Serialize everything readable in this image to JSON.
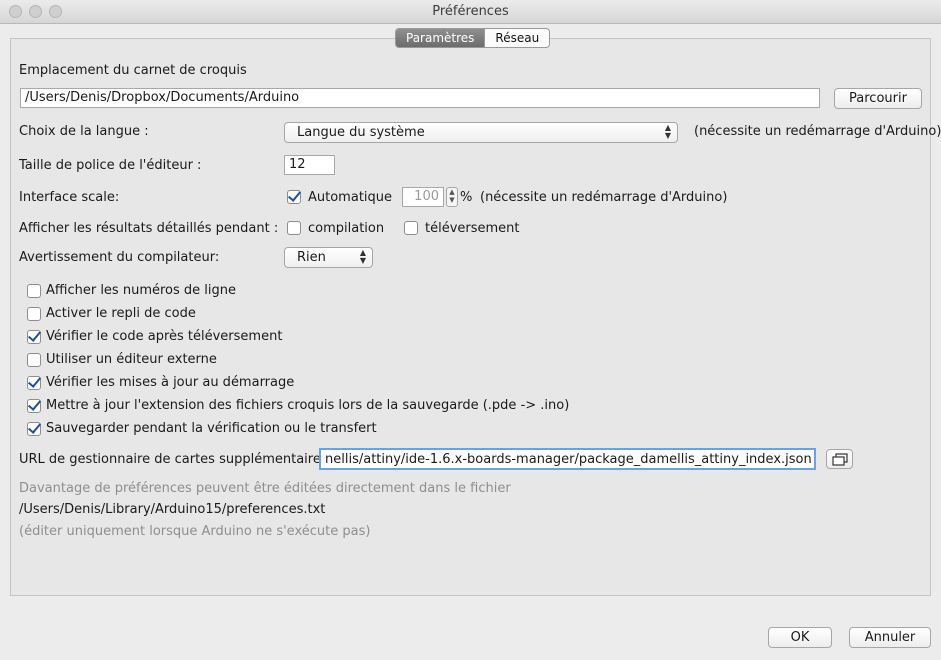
{
  "window": {
    "title": "Préférences"
  },
  "tabs": [
    {
      "label": "Paramètres",
      "active": true
    },
    {
      "label": "Réseau",
      "active": false
    }
  ],
  "sketchbook": {
    "label": "Emplacement du carnet de croquis",
    "path": "/Users/Denis/Dropbox/Documents/Arduino",
    "browse_label": "Parcourir"
  },
  "language": {
    "label": "Choix de la langue :",
    "selected": "Langue du système",
    "note": "(nécessite un redémarrage d'Arduino)"
  },
  "font_size": {
    "label": "Taille de police de l'éditeur :",
    "value": "12"
  },
  "interface_scale": {
    "label": "Interface scale:",
    "auto_label": "Automatique",
    "auto_checked": true,
    "value": "100",
    "unit": "%",
    "note": "(nécessite un redémarrage d'Arduino)"
  },
  "verbose": {
    "label": "Afficher les résultats détaillés pendant :",
    "compile_label": "compilation",
    "compile_checked": false,
    "upload_label": "téléversement",
    "upload_checked": false
  },
  "warnings": {
    "label": "Avertissement du compilateur:",
    "selected": "Rien"
  },
  "options": [
    {
      "label": "Afficher les numéros de ligne",
      "checked": false
    },
    {
      "label": "Activer le repli de code",
      "checked": false
    },
    {
      "label": "Vérifier le code après téléversement",
      "checked": true
    },
    {
      "label": "Utiliser un éditeur externe",
      "checked": false
    },
    {
      "label": "Vérifier les mises à jour au démarrage",
      "checked": true
    },
    {
      "label": "Mettre à jour  l'extension des fichiers croquis lors de la sauvegarde (.pde -> .ino)",
      "checked": true
    },
    {
      "label": "Sauvegarder pendant la vérification ou le transfert",
      "checked": true
    }
  ],
  "boards_url": {
    "label": "URL de gestionnaire de cartes supplémentaires",
    "value": "nellis/attiny/ide-1.6.x-boards-manager/package_damellis_attiny_index.json"
  },
  "more_prefs": {
    "note": "Davantage de préférences peuvent être éditées directement dans le fichier",
    "path": "/Users/Denis/Library/Arduino15/preferences.txt",
    "hint": "(éditer uniquement lorsque Arduino ne s'exécute pas)"
  },
  "footer": {
    "ok_label": "OK",
    "cancel_label": "Annuler"
  }
}
